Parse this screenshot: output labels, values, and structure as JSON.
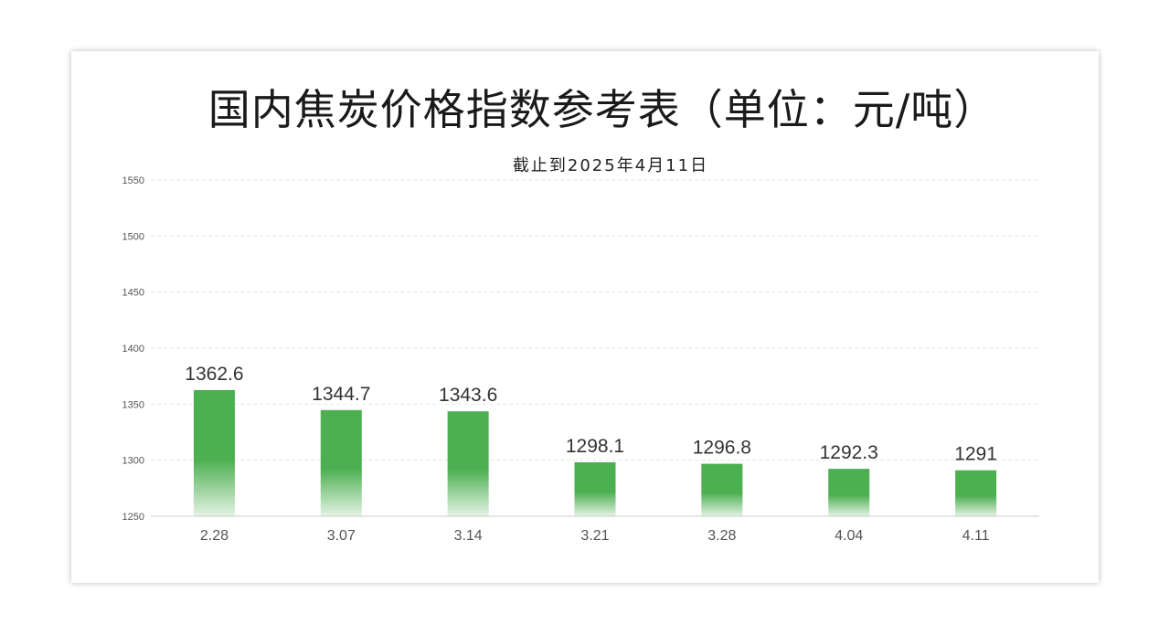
{
  "chart_data": {
    "type": "bar",
    "title": "国内焦炭价格指数参考表（单位：元/吨）",
    "subtitle": "截止到2025年4月11日",
    "categories": [
      "2.28",
      "3.07",
      "3.14",
      "3.21",
      "3.28",
      "4.04",
      "4.11"
    ],
    "values": [
      1362.6,
      1344.7,
      1343.6,
      1298.1,
      1296.8,
      1292.3,
      1291
    ],
    "data_labels": [
      "1362.6",
      "1344.7",
      "1343.6",
      "1298.1",
      "1296.8",
      "1292.3",
      "1291"
    ],
    "ylim": [
      1250,
      1550
    ],
    "yticks": [
      "1250",
      "1300",
      "1350",
      "1400",
      "1450",
      "1500",
      "1550"
    ],
    "ytick_values": [
      1250,
      1300,
      1350,
      1400,
      1450,
      1500,
      1550
    ],
    "xlabel": "",
    "ylabel": "",
    "grid": true,
    "legend": "none",
    "bar_color": "#4caf50"
  }
}
